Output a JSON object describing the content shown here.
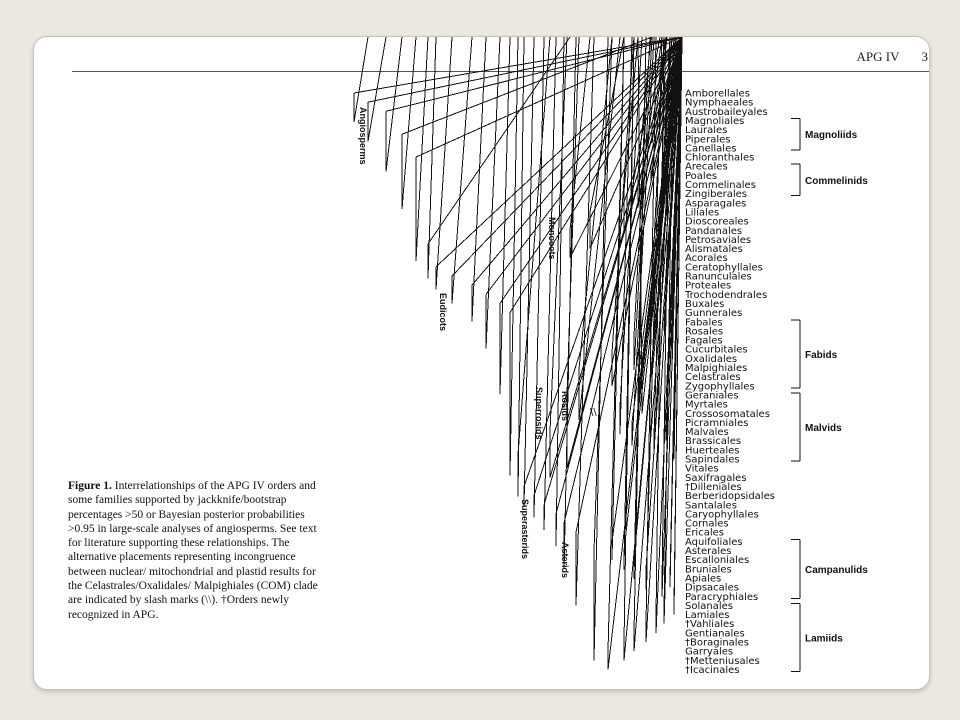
{
  "header": {
    "journal": "APG IV",
    "page": "3"
  },
  "caption": {
    "label": "Figure 1.",
    "text": "Interrelationships of the APG IV orders and some families supported by jackknife/bootstrap percentages >50 or Bayesian posterior probabilities >0.95 in large-scale analyses of angiosperms. See text for literature supporting these relationships. The alternative placements representing incongruence between nuclear/ mitochondrial and plastid results for the Celastrales/Oxalidales/ Malpighiales (COM) clade are indicated by slash marks (\\\\). †Orders newly recognized in APG."
  },
  "orders": [
    "Amborellales",
    "Nymphaeales",
    "Austrobaileyales",
    "Magnoliales",
    "Laurales",
    "Piperales",
    "Canellales",
    "Chloranthales",
    "Arecales",
    "Poales",
    "Commelinales",
    "Zingiberales",
    "Asparagales",
    "Liliales",
    "Dioscoreales",
    "Pandanales",
    "Petrosaviales",
    "Alismatales",
    "Acorales",
    "Ceratophyllales",
    "Ranunculales",
    "Proteales",
    "Trochodendrales",
    "Buxales",
    "Gunnerales",
    "Fabales",
    "Rosales",
    "Fagales",
    "Cucurbitales",
    "Oxalidales",
    "Malpighiales",
    "Celastrales",
    "Zygophyllales",
    "Geraniales",
    "Myrtales",
    "Crossosomatales",
    "Picramniales",
    "Malvales",
    "Brassicales",
    "Huerteales",
    "Sapindales",
    "Vitales",
    "Saxifragales",
    "†Dilleniales",
    "Berberidopsidales",
    "Santalales",
    "Caryophyllales",
    "Cornales",
    "Ericales",
    "Aquifoliales",
    "Asterales",
    "Escalloniales",
    "Bruniales",
    "Apiales",
    "Dipsacales",
    "Paracryphiales",
    "Solanales",
    "Lamiales",
    "†Vahliales",
    "Gentianales",
    "†Boraginales",
    "Garryales",
    "†Metteniusales",
    "†Icacinales"
  ],
  "bracket_labels": {
    "magnoliids": "Magnoliids",
    "commelinids": "Commelinids",
    "fabids": "Fabids",
    "malvids": "Malvids",
    "campanulids": "Campanulids",
    "lamiids": "Lamiids"
  },
  "node_labels": {
    "angiosperms": "Angiosperms",
    "monocots": "Monocots",
    "eudicots": "Eudicots",
    "superrosids": "Superrosids",
    "rosids": "Rosids",
    "superasterids": "Superasterids",
    "asterids": "Asterids"
  },
  "slash_mark": "\\\\"
}
